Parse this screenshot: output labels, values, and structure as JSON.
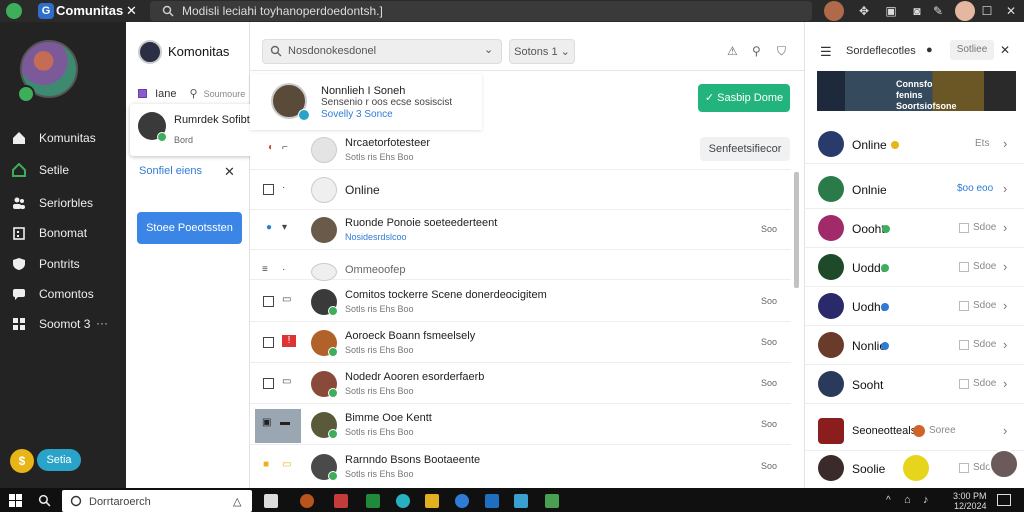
{
  "titlebar": {
    "app_title": "Comunitas",
    "address": "Modisli leciahi toyhanoperdoedontsh.]"
  },
  "sidebar": {
    "items": [
      {
        "label": "Komunitas",
        "icon": "home-icon"
      },
      {
        "label": "Setile",
        "icon": "house-icon"
      },
      {
        "label": "Seriorbles",
        "icon": "people-icon"
      },
      {
        "label": "Bonomat",
        "icon": "building-icon"
      },
      {
        "label": "Pontrits",
        "icon": "shield-icon"
      },
      {
        "label": "Comontos",
        "icon": "chat-icon"
      },
      {
        "label": "Soomot 3",
        "icon": "grid-icon",
        "extra": "···"
      }
    ],
    "coin_label": "$",
    "pill_label": "Setia"
  },
  "col2": {
    "title": "Komonitas",
    "row_label": "Iane",
    "row_extra": "Soumoure",
    "card_name": "Rumrdek Sofibties",
    "card_sub": "Bord",
    "link": "Sonfiel eiens",
    "button": "Stoee Poeotssten"
  },
  "main": {
    "search_placeholder": "Nosdonokesdonel",
    "sort_label": "Sotons 1",
    "featured_name": "Nonnlieh I Soneh",
    "featured_sub": "Sensenio r oos ecse sosiscist",
    "featured_sub2": "Sovelly 3 Sonce",
    "setup_button": "Sasbip Dome",
    "select_button": "Senfeetsifiecor",
    "rows": [
      {
        "name": "Nrcaetorfotesteer",
        "sub": "Sotls ris Ehs Boo",
        "time": ""
      },
      {
        "name": "Online",
        "sub": "",
        "time": ""
      },
      {
        "name": "Ruonde Ponoie soeteederteent",
        "sub": "Nosidesrdslcoo",
        "time": "Soo"
      },
      {
        "name": "Ommeoofep",
        "sub": "",
        "time": ""
      },
      {
        "name": "Comitos tockerre Scene donerdeocigitem",
        "sub": "Sotls ris Ehs Boo",
        "time": "Soo"
      },
      {
        "name": "Aoroeck Boann fsmeelsely",
        "sub": "Sotls ris Ehs Boo",
        "time": "Soo"
      },
      {
        "name": "Nodedr Aooren esorderfaerb",
        "sub": "Sotls ris Ehs Boo",
        "time": "Soo"
      },
      {
        "name": "Bimme Ooe Kentt",
        "sub": "Sotls ris Ehs Boo",
        "time": "Soo"
      },
      {
        "name": "Rarnndo Bsons Bootaeente",
        "sub": "Sotls ris Ehs Boo",
        "time": "Soo"
      }
    ]
  },
  "right": {
    "title": "Sordeflecotles",
    "mini_label": "Sotliee",
    "banner_text": "Connsfo fenins Soortsiofsone",
    "rows": [
      {
        "name": "Online",
        "value": "Ets",
        "dot": "#e8b416"
      },
      {
        "name": "Onlnie",
        "value": "$oo eoo",
        "dot": ""
      },
      {
        "name": "Oooht",
        "value": "Sdoe",
        "dot": "#3fae5a"
      },
      {
        "name": "Uodde",
        "value": "Sdoe",
        "dot": "#3fae5a"
      },
      {
        "name": "Uodhe",
        "value": "Sdoe",
        "dot": "#2f7bd6"
      },
      {
        "name": "Nonlie",
        "value": "Sdoe",
        "dot": "#2f7bd6"
      },
      {
        "name": "Sooht",
        "value": "Sdoe",
        "dot": ""
      },
      {
        "name": "Seoneotteals",
        "value": "Soree",
        "dot": ""
      },
      {
        "name": "Soolie",
        "value": "Sdoe",
        "dot": ""
      }
    ]
  },
  "taskbar": {
    "search_placeholder": "Dorrtaroerch",
    "clock_time": "3:00 PM",
    "clock_date": "12/2024"
  }
}
